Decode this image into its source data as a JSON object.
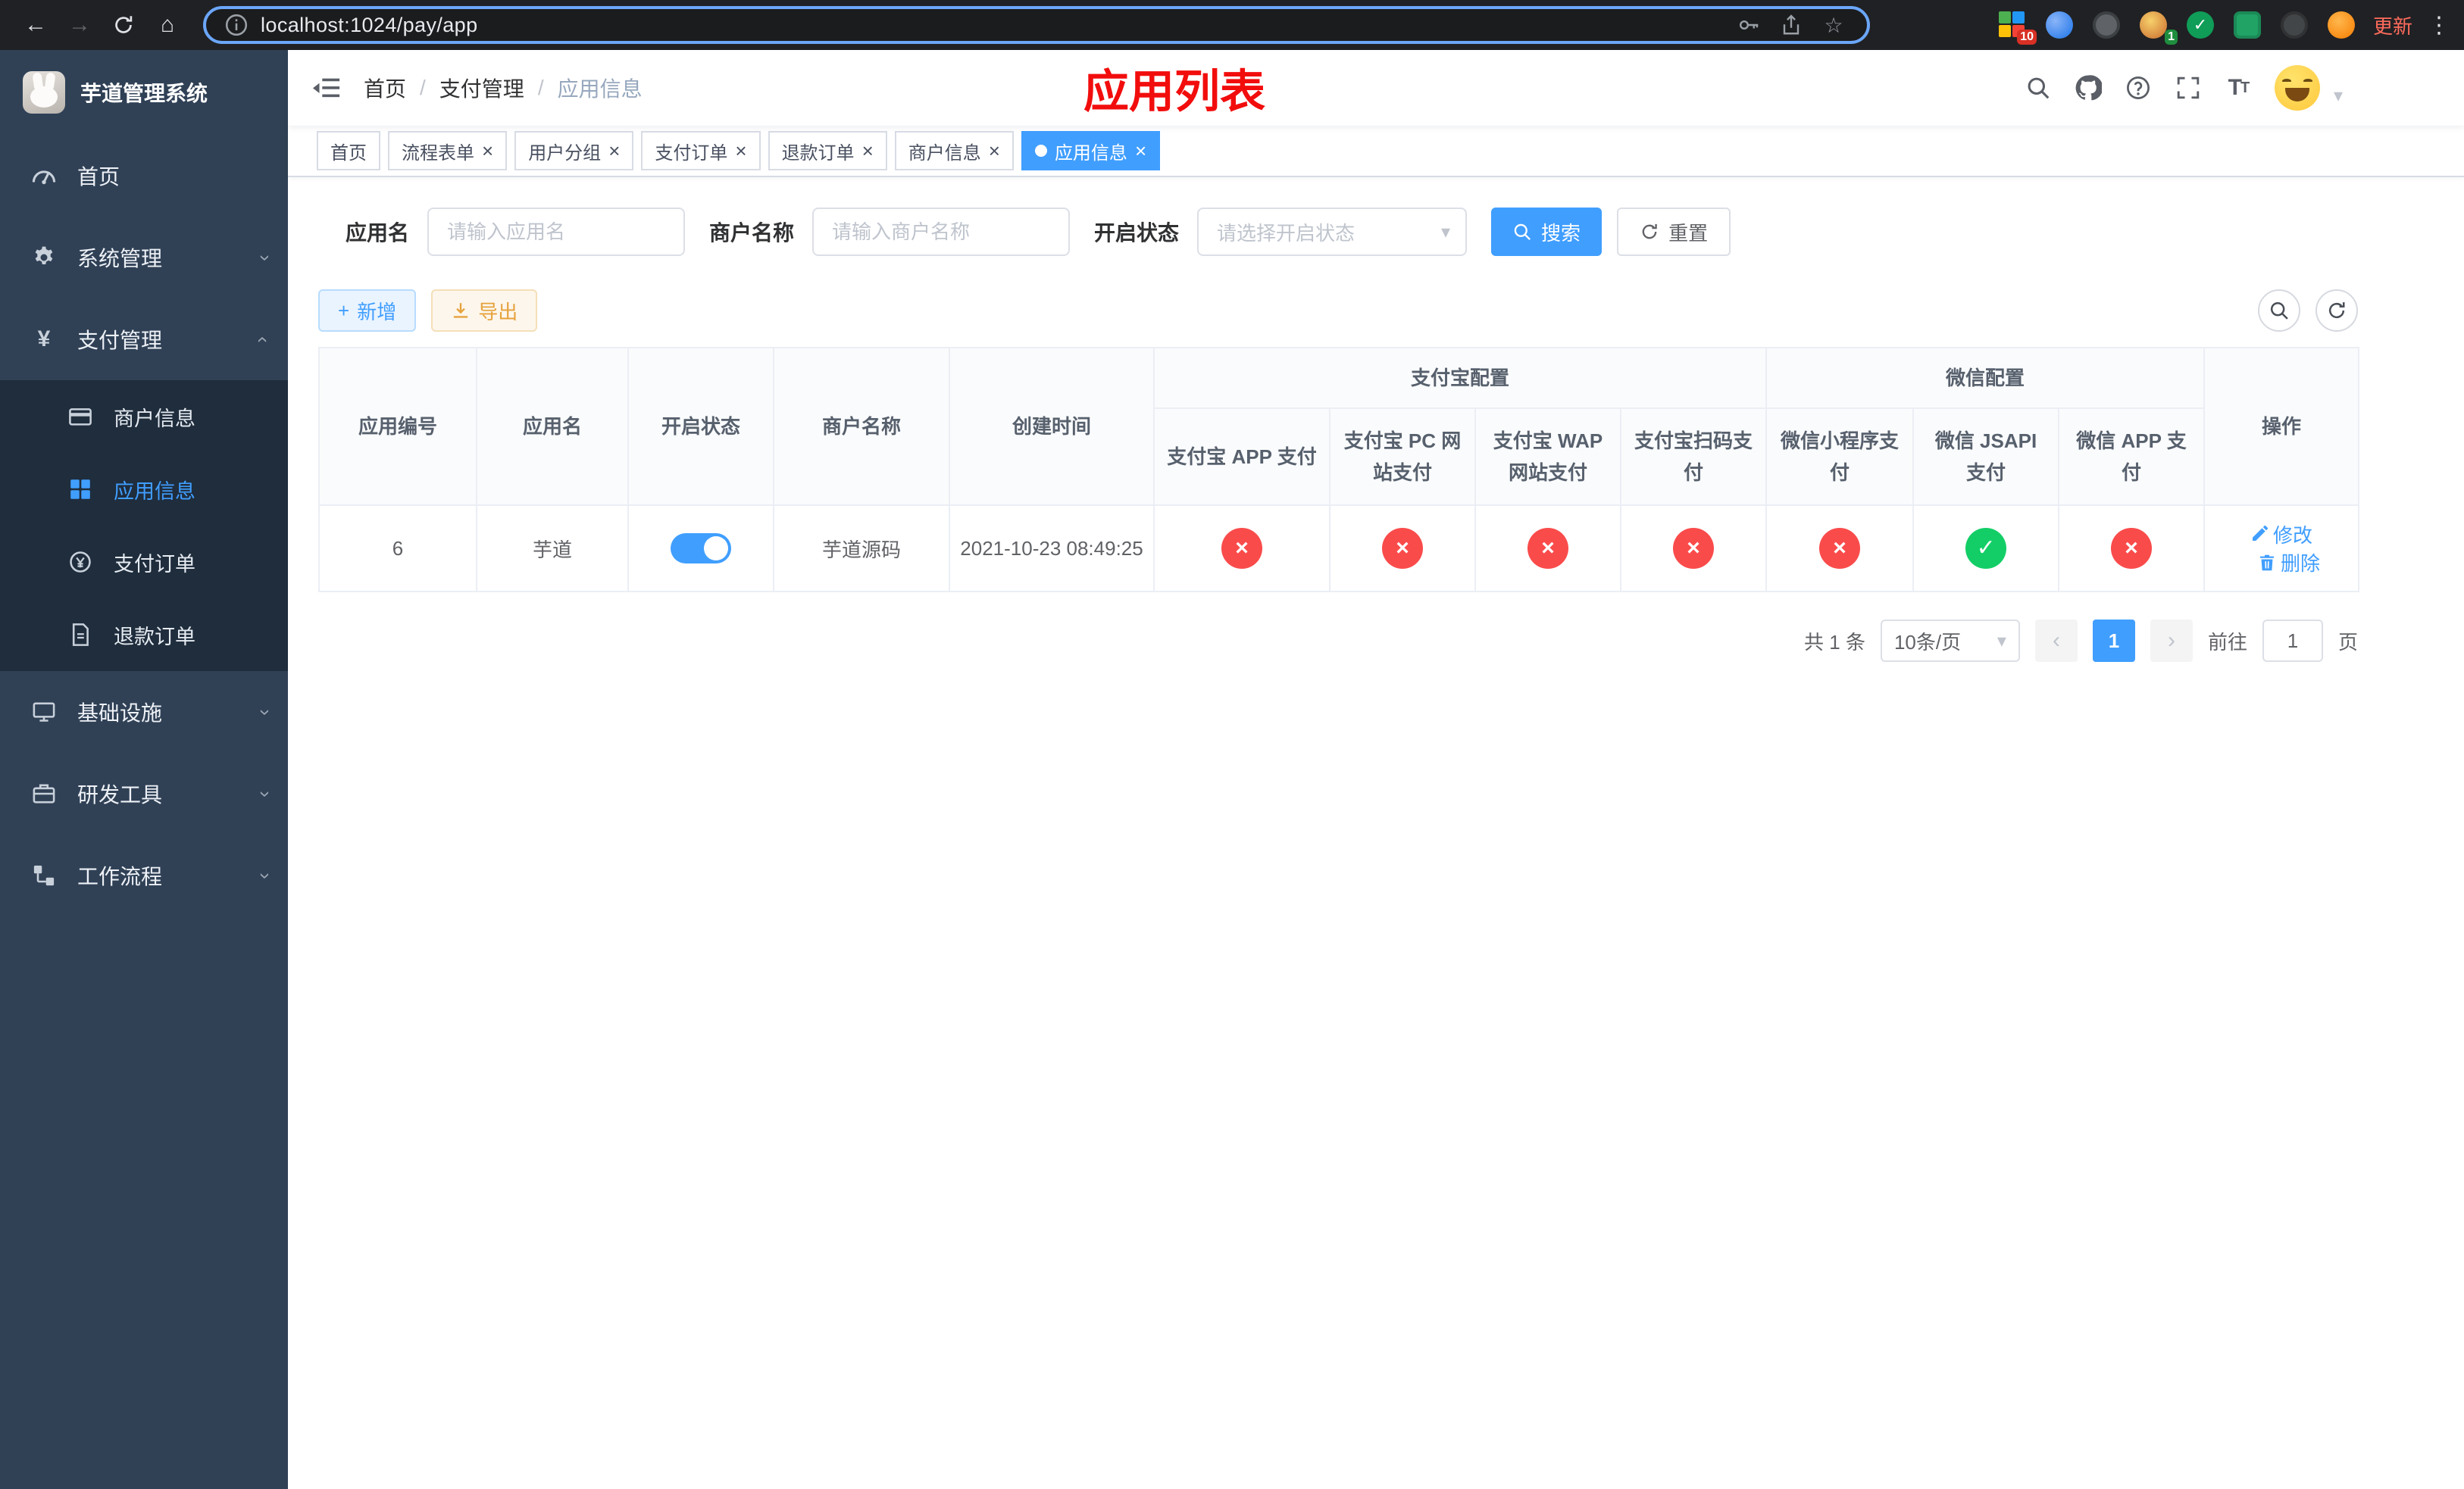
{
  "browser": {
    "url": "localhost:1024/pay/app",
    "update_label": "更新",
    "ext_badge_grid": "10",
    "ext_badge_avatar": "1"
  },
  "icons": {
    "back": "←",
    "forward": "→",
    "home": "⌂",
    "star": "☆",
    "kebab": "⋮",
    "yen": "¥",
    "close": "×",
    "check": "✓",
    "caret_down": "▾",
    "chevron_left": "‹",
    "chevron_right": "›",
    "plus": "+",
    "slash": "/"
  },
  "sidebar": {
    "logo_title": "芋道管理系统",
    "items": [
      {
        "label": "首页"
      },
      {
        "label": "系统管理"
      },
      {
        "label": "支付管理"
      },
      {
        "label": "商户信息"
      },
      {
        "label": "应用信息"
      },
      {
        "label": "支付订单"
      },
      {
        "label": "退款订单"
      },
      {
        "label": "基础设施"
      },
      {
        "label": "研发工具"
      },
      {
        "label": "工作流程"
      }
    ]
  },
  "navbar": {
    "breadcrumb": [
      "首页",
      "支付管理",
      "应用信息"
    ],
    "page_title": "应用列表"
  },
  "tabs": [
    {
      "label": "首页"
    },
    {
      "label": "流程表单"
    },
    {
      "label": "用户分组"
    },
    {
      "label": "支付订单"
    },
    {
      "label": "退款订单"
    },
    {
      "label": "商户信息"
    },
    {
      "label": "应用信息"
    }
  ],
  "filters": {
    "app_name_label": "应用名",
    "app_name_placeholder": "请输入应用名",
    "merchant_label": "商户名称",
    "merchant_placeholder": "请输入商户名称",
    "status_label": "开启状态",
    "status_placeholder": "请选择开启状态",
    "search_label": "搜索",
    "reset_label": "重置"
  },
  "toolbar": {
    "add_label": "新增",
    "export_label": "导出"
  },
  "table": {
    "headers": {
      "app_id": "应用编号",
      "app_name": "应用名",
      "status": "开启状态",
      "merchant": "商户名称",
      "created": "创建时间",
      "alipay_group": "支付宝配置",
      "wechat_group": "微信配置",
      "alipay_app": "支付宝 APP 支付",
      "alipay_pc": "支付宝 PC 网站支付",
      "alipay_wap": "支付宝 WAP 网站支付",
      "alipay_qr": "支付宝扫码支付",
      "wechat_mini": "微信小程序支付",
      "wechat_jsapi": "微信 JSAPI 支付",
      "wechat_app": "微信 APP 支付",
      "actions": "操作"
    },
    "rows": [
      {
        "app_id": "6",
        "app_name": "芋道",
        "status_on": true,
        "merchant": "芋道源码",
        "created": "2021-10-23 08:49:25",
        "configs": {
          "alipay_app": false,
          "alipay_pc": false,
          "alipay_wap": false,
          "alipay_qr": false,
          "wechat_mini": false,
          "wechat_jsapi": true,
          "wechat_app": false
        },
        "edit_label": "修改",
        "delete_label": "删除"
      }
    ]
  },
  "pagination": {
    "total": "共 1 条",
    "page_size": "10条/页",
    "current_page": "1",
    "goto_label": "前往",
    "goto_value": "1",
    "goto_unit": "页"
  },
  "colors": {
    "accent_blue": "#409EFF",
    "danger_red": "#fa4b4b",
    "success_green": "#13ce66",
    "title_red": "#f20d0d",
    "sidebar_bg": "#304156",
    "submenu_bg": "#1f2d3d"
  }
}
